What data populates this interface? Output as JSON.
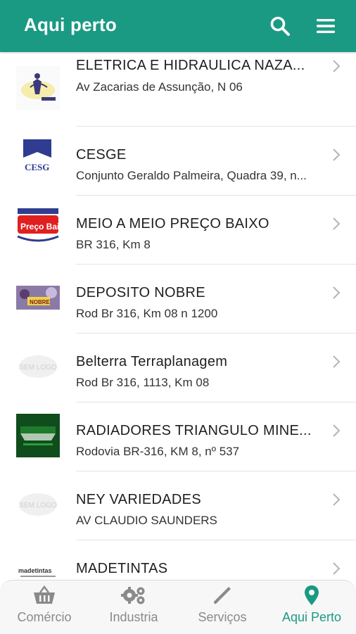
{
  "header": {
    "title": "Aqui perto",
    "search_icon": "search-icon",
    "menu_icon": "hamburger-menu-icon"
  },
  "colors": {
    "primary": "#1b9a83",
    "nav_inactive": "#8a8a8a"
  },
  "items": [
    {
      "name": "ELETRICA E HIDRAULICA NAZA...",
      "address": "Av Zacarias de Assunção, N 06",
      "logo": "eletrica-logo"
    },
    {
      "name": "CESGE",
      "address": "Conjunto Geraldo Palmeira, Quadra 39, n...",
      "logo": "cesge-logo",
      "logo_text": "CESG"
    },
    {
      "name": "MEIO A MEIO PREÇO BAIXO",
      "address": "BR 316, Km 8",
      "logo": "preco-baixo-logo",
      "logo_text": "Preço Baixo"
    },
    {
      "name": "DEPOSITO NOBRE",
      "address": "Rod Br 316, Km 08 n 1200",
      "logo": "deposito-nobre-logo",
      "logo_text": "NOBRE"
    },
    {
      "name": "Belterra Terraplanagem",
      "address": "Rod Br 316, 1113, Km 08",
      "logo": "sem-logo",
      "logo_text": "SEM LOGO"
    },
    {
      "name": "RADIADORES TRIANGULO MINE...",
      "address": "Rodovia BR-316, KM 8, nº 537",
      "logo": "radiadores-logo"
    },
    {
      "name": "NEY VARIEDADES",
      "address": "AV CLAUDIO SAUNDERS",
      "logo": "sem-logo",
      "logo_text": "SEM LOGO"
    },
    {
      "name": "MADETINTAS",
      "address": "",
      "logo": "madetintas-logo",
      "logo_text": "madetintas"
    }
  ],
  "bottom_nav": [
    {
      "label": "Comércio",
      "icon": "basket-icon",
      "active": false
    },
    {
      "label": "Industria",
      "icon": "gears-icon",
      "active": false
    },
    {
      "label": "Serviços",
      "icon": "tools-icon",
      "active": false
    },
    {
      "label": "Aqui Perto",
      "icon": "location-pin-icon",
      "active": true
    }
  ]
}
